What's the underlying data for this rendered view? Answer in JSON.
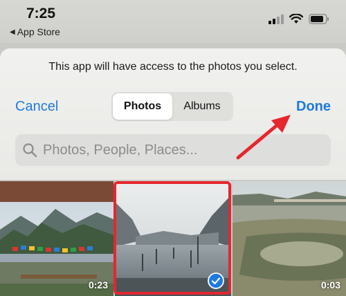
{
  "status_bar": {
    "time": "7:25",
    "back_app": "App Store"
  },
  "sheet": {
    "message": "This app will have access to the photos you select.",
    "cancel_label": "Cancel",
    "done_label": "Done",
    "tabs": [
      {
        "label": "Photos",
        "selected": true
      },
      {
        "label": "Albums",
        "selected": false
      }
    ],
    "search": {
      "placeholder": "Photos, People, Places...",
      "value": ""
    }
  },
  "photos": [
    {
      "duration": "0:23",
      "selected": false
    },
    {
      "duration": "",
      "selected": true
    },
    {
      "duration": "0:03",
      "selected": false
    }
  ],
  "colors": {
    "accent": "#1f7ae0",
    "annotation": "#e5262f"
  }
}
